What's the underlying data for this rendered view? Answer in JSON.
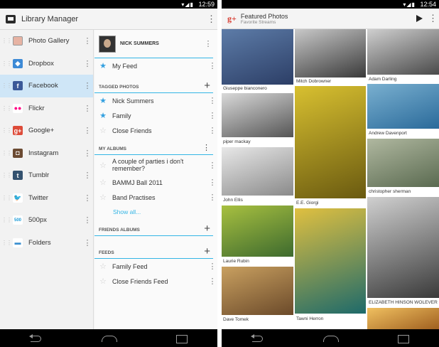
{
  "left": {
    "status_time": "12:59",
    "title": "Library Manager",
    "drawer": [
      {
        "label": "Photo Gallery",
        "icon": "photo-gallery-icon",
        "color": "#e7b3a3",
        "glyph": ""
      },
      {
        "label": "Dropbox",
        "icon": "dropbox-icon",
        "color": "#3d8ad6",
        "glyph": "◆"
      },
      {
        "label": "Facebook",
        "icon": "facebook-icon",
        "color": "#3b5998",
        "glyph": "f",
        "selected": true
      },
      {
        "label": "Flickr",
        "icon": "flickr-icon",
        "color": "#ffffff",
        "glyph": "●●"
      },
      {
        "label": "Google+",
        "icon": "google-plus-icon",
        "color": "#dd4b39",
        "glyph": "g+"
      },
      {
        "label": "Instagram",
        "icon": "instagram-icon",
        "color": "#6b4a32",
        "glyph": "◘"
      },
      {
        "label": "Tumblr",
        "icon": "tumblr-icon",
        "color": "#34526f",
        "glyph": "t"
      },
      {
        "label": "Twitter",
        "icon": "twitter-icon",
        "color": "#ffffff",
        "glyph": "🐦"
      },
      {
        "label": "500px",
        "icon": "500px-icon",
        "color": "#ffffff",
        "glyph": "500"
      },
      {
        "label": "Folders",
        "icon": "folder-icon",
        "color": "#ffffff",
        "glyph": "▬"
      }
    ],
    "profile_name": "NICK SUMMERS",
    "my_feed": "My Feed",
    "sections": {
      "tagged": "TAGGED PHOTOS",
      "albums": "MY ALBUMS",
      "friends": "FRIENDS ALBUMS",
      "feeds": "FEEDS"
    },
    "tagged_items": [
      {
        "label": "Nick Summers",
        "starred": true
      },
      {
        "label": "Family",
        "starred": true
      },
      {
        "label": "Close Friends",
        "starred": false
      }
    ],
    "album_items": [
      {
        "label": "A couple of parties i don't remember?",
        "starred": false
      },
      {
        "label": "BAMMJ Ball 2011",
        "starred": false
      },
      {
        "label": "Band Practises",
        "starred": false
      }
    ],
    "show_all": "Show all...",
    "feed_items": [
      {
        "label": "Family Feed",
        "starred": false
      },
      {
        "label": "Close Friends Feed",
        "starred": false
      }
    ]
  },
  "right": {
    "status_time": "12:54",
    "title": "Featured Photos",
    "subtitle": "Favorite Streams",
    "photos": [
      {
        "caption": "Giuseppe bianconero",
        "colors": [
          "#5d7ca8",
          "#2c3e66"
        ]
      },
      {
        "caption": "piper mackay",
        "colors": [
          "#d9d9d9",
          "#555555"
        ]
      },
      {
        "caption": "John Ellis",
        "colors": [
          "#e8e8e8",
          "#8a8a8a"
        ]
      },
      {
        "caption": "Laurie Rubin",
        "colors": [
          "#a8c040",
          "#3d6a2e"
        ]
      },
      {
        "caption": "Dave Tomek",
        "colors": [
          "#c9a060",
          "#6b4a2a"
        ]
      },
      {
        "caption": "Mitch Dobrowner",
        "colors": [
          "#c8c8c8",
          "#3a3a3a"
        ]
      },
      {
        "caption": "E.E. Giorgi",
        "colors": [
          "#d8c030",
          "#6a5a10"
        ]
      },
      {
        "caption": "Tawni Herron",
        "colors": [
          "#e0c040",
          "#1e6a6a"
        ]
      },
      {
        "caption": "Adam Darling",
        "colors": [
          "#cfcfcf",
          "#4a4a4a"
        ]
      },
      {
        "caption": "Andrew Davenport",
        "colors": [
          "#7ab0d0",
          "#2a6a9a"
        ]
      },
      {
        "caption": "christopher sherman",
        "colors": [
          "#b0b8a0",
          "#5a6a50"
        ]
      },
      {
        "caption": "ELIZABETH HINSON WOLEVER",
        "colors": [
          "#d0d0d0",
          "#3a3a3a"
        ]
      },
      {
        "caption": "",
        "colors": [
          "#f0c060",
          "#a06020"
        ]
      }
    ]
  }
}
